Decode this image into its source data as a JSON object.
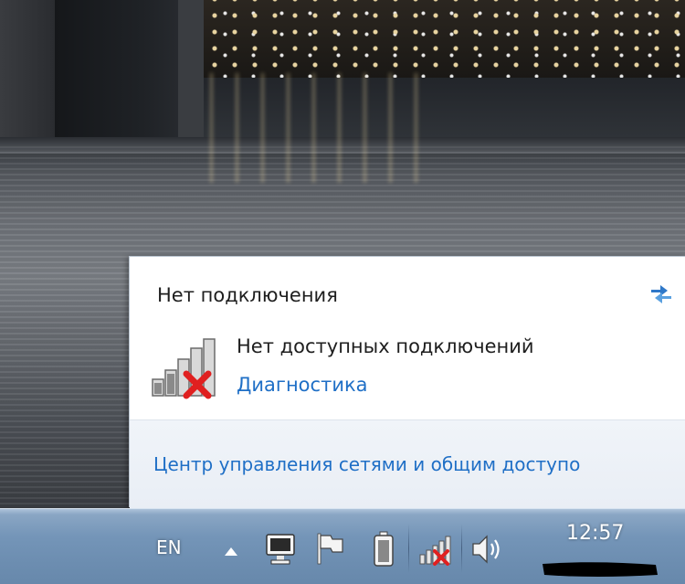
{
  "flyout": {
    "title": "Нет подключения",
    "status_text": "Нет доступных подключений",
    "diagnostics_link": "Диагностика",
    "network_center_link": "Центр управления сетями и общим доступо"
  },
  "taskbar": {
    "language": "EN",
    "clock_time": "12:57"
  },
  "icons": {
    "refresh": "refresh-icon",
    "no_connection": "signal-no-connection-icon",
    "show_hidden": "chevron-up-icon",
    "display": "monitor-icon",
    "action_center": "flag-icon",
    "battery": "battery-icon",
    "network": "network-no-connection-icon",
    "volume": "speaker-icon"
  },
  "colors": {
    "link": "#1f6fc6",
    "error_x": "#e02020",
    "taskbar": "#7495b8"
  }
}
